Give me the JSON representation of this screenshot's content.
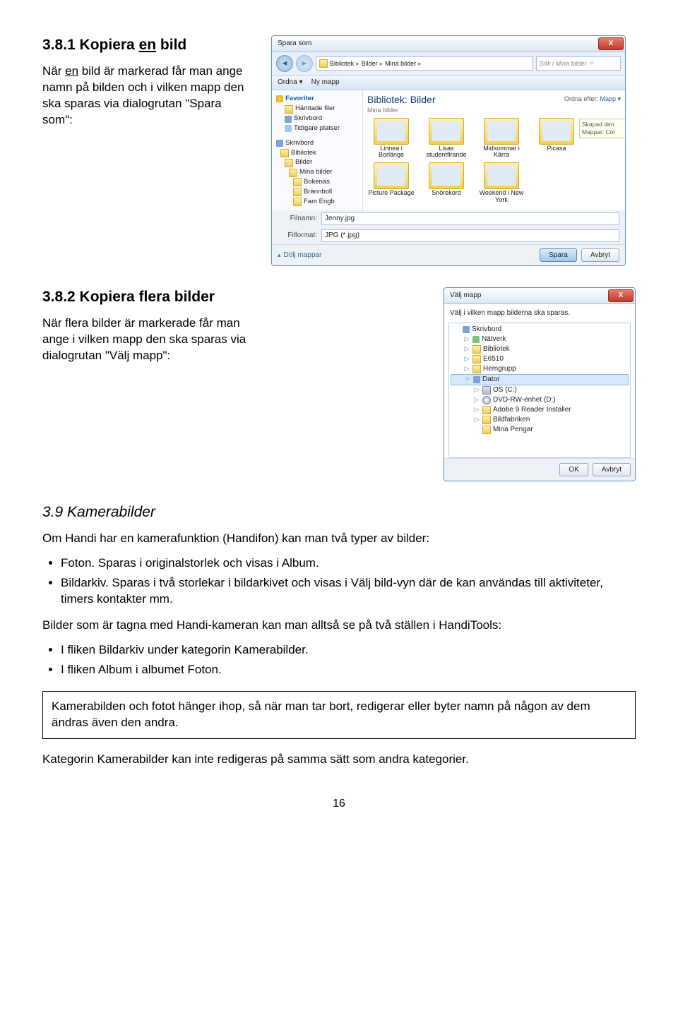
{
  "sections": {
    "s381": {
      "heading_prefix": "3.8.1 Kopiera ",
      "heading_underline": "en",
      "heading_suffix": " bild",
      "para_a": "När ",
      "para_u": "en",
      "para_b": " bild är markerad får man ange namn på bilden och i vilken mapp den ska sparas via dialogrutan \"Spara som\":"
    },
    "s382": {
      "heading": "3.8.2 Kopiera flera bilder",
      "para": "När flera bilder är markerade får man ange i vilken mapp den ska sparas via dialogrutan \"Välj mapp\":"
    },
    "s39": {
      "heading": "3.9 Kamerabilder",
      "intro": "Om Handi har en kamerafunktion (Handifon) kan man två typer av bilder:",
      "bullets1": [
        "Foton. Sparas i originalstorlek och visas i Album.",
        "Bildarkiv. Sparas i två storlekar i bildarkivet och visas i Välj bild-vyn där de kan användas till aktiviteter, timers kontakter mm."
      ],
      "para2": "Bilder som är tagna med Handi-kameran kan man alltså se på två ställen i HandiTools:",
      "bullets2": [
        "I fliken Bildarkiv under kategorin Kamerabilder.",
        "I fliken Album i albumet Foton."
      ],
      "note": "Kamerabilden och fotot hänger ihop, så när man tar bort, redigerar eller byter namn på någon av dem ändras även den andra.",
      "para3": "Kategorin Kamerabilder kan inte redigeras på samma sätt som andra kategorier."
    }
  },
  "page_number": "16",
  "save_dialog": {
    "title": "Spara som",
    "crumbs": [
      "Bibliotek",
      "Bilder",
      "Mina bilder"
    ],
    "search_placeholder": "Sök i Mina bilder",
    "toolbar": {
      "organize": "Ordna ▾",
      "newfolder": "Ny mapp"
    },
    "lib_title": "Bibliotek: Bilder",
    "lib_sub": "Mina bilder",
    "order_label": "Ordna efter:",
    "order_value": "Mapp ▾",
    "sidebar": {
      "fav": "Favoriter",
      "fav_items": [
        "Hämtade filer",
        "Skrivbord",
        "Tidigare platser"
      ],
      "root_items": [
        "Skrivbord",
        "Bibliotek",
        "Bilder",
        "Mina bilder",
        "Bokenäs",
        "Brännboll",
        "Fam Engb"
      ]
    },
    "folders": [
      "Linnea i Borlänge",
      "Lisas studentfirande",
      "Midsommar i Kärra",
      "Picasa",
      "Picture Package",
      "Snörekord",
      "Weekend i New York"
    ],
    "tag_created": "Skapad den:",
    "tag_dirs": "Mappar: Col",
    "filename_label": "Filnamn:",
    "filename_value": "Jenny.jpg",
    "format_label": "Filformat:",
    "format_value": "JPG (*.jpg)",
    "hide_folders": "Dölj mappar",
    "save": "Spara",
    "cancel": "Avbryt"
  },
  "picker_dialog": {
    "title": "Välj mapp",
    "instruction": "Välj i vilken mapp bilderna ska sparas.",
    "tree": [
      {
        "indent": 0,
        "arrow": "",
        "icon": "desk",
        "label": "Skrivbord"
      },
      {
        "indent": 1,
        "arrow": "▷",
        "icon": "net",
        "label": "Nätverk"
      },
      {
        "indent": 1,
        "arrow": "▷",
        "icon": "folder",
        "label": "Bibliotek"
      },
      {
        "indent": 1,
        "arrow": "▷",
        "icon": "folder",
        "label": "E6510"
      },
      {
        "indent": 1,
        "arrow": "▷",
        "icon": "folder",
        "label": "Hemgrupp"
      },
      {
        "indent": 1,
        "arrow": "▿",
        "icon": "desk",
        "label": "Dator",
        "selected": true
      },
      {
        "indent": 2,
        "arrow": "▷",
        "icon": "drive",
        "label": "OS (C:)"
      },
      {
        "indent": 2,
        "arrow": "▷",
        "icon": "dvd",
        "label": "DVD-RW-enhet (D:)"
      },
      {
        "indent": 2,
        "arrow": "▷",
        "icon": "folder",
        "label": "Adobe 9 Reader Installer"
      },
      {
        "indent": 2,
        "arrow": "▷",
        "icon": "folder",
        "label": "Bildfabriken"
      },
      {
        "indent": 2,
        "arrow": "",
        "icon": "folder",
        "label": "Mina Pengar"
      }
    ],
    "ok": "OK",
    "cancel": "Avbryt"
  }
}
